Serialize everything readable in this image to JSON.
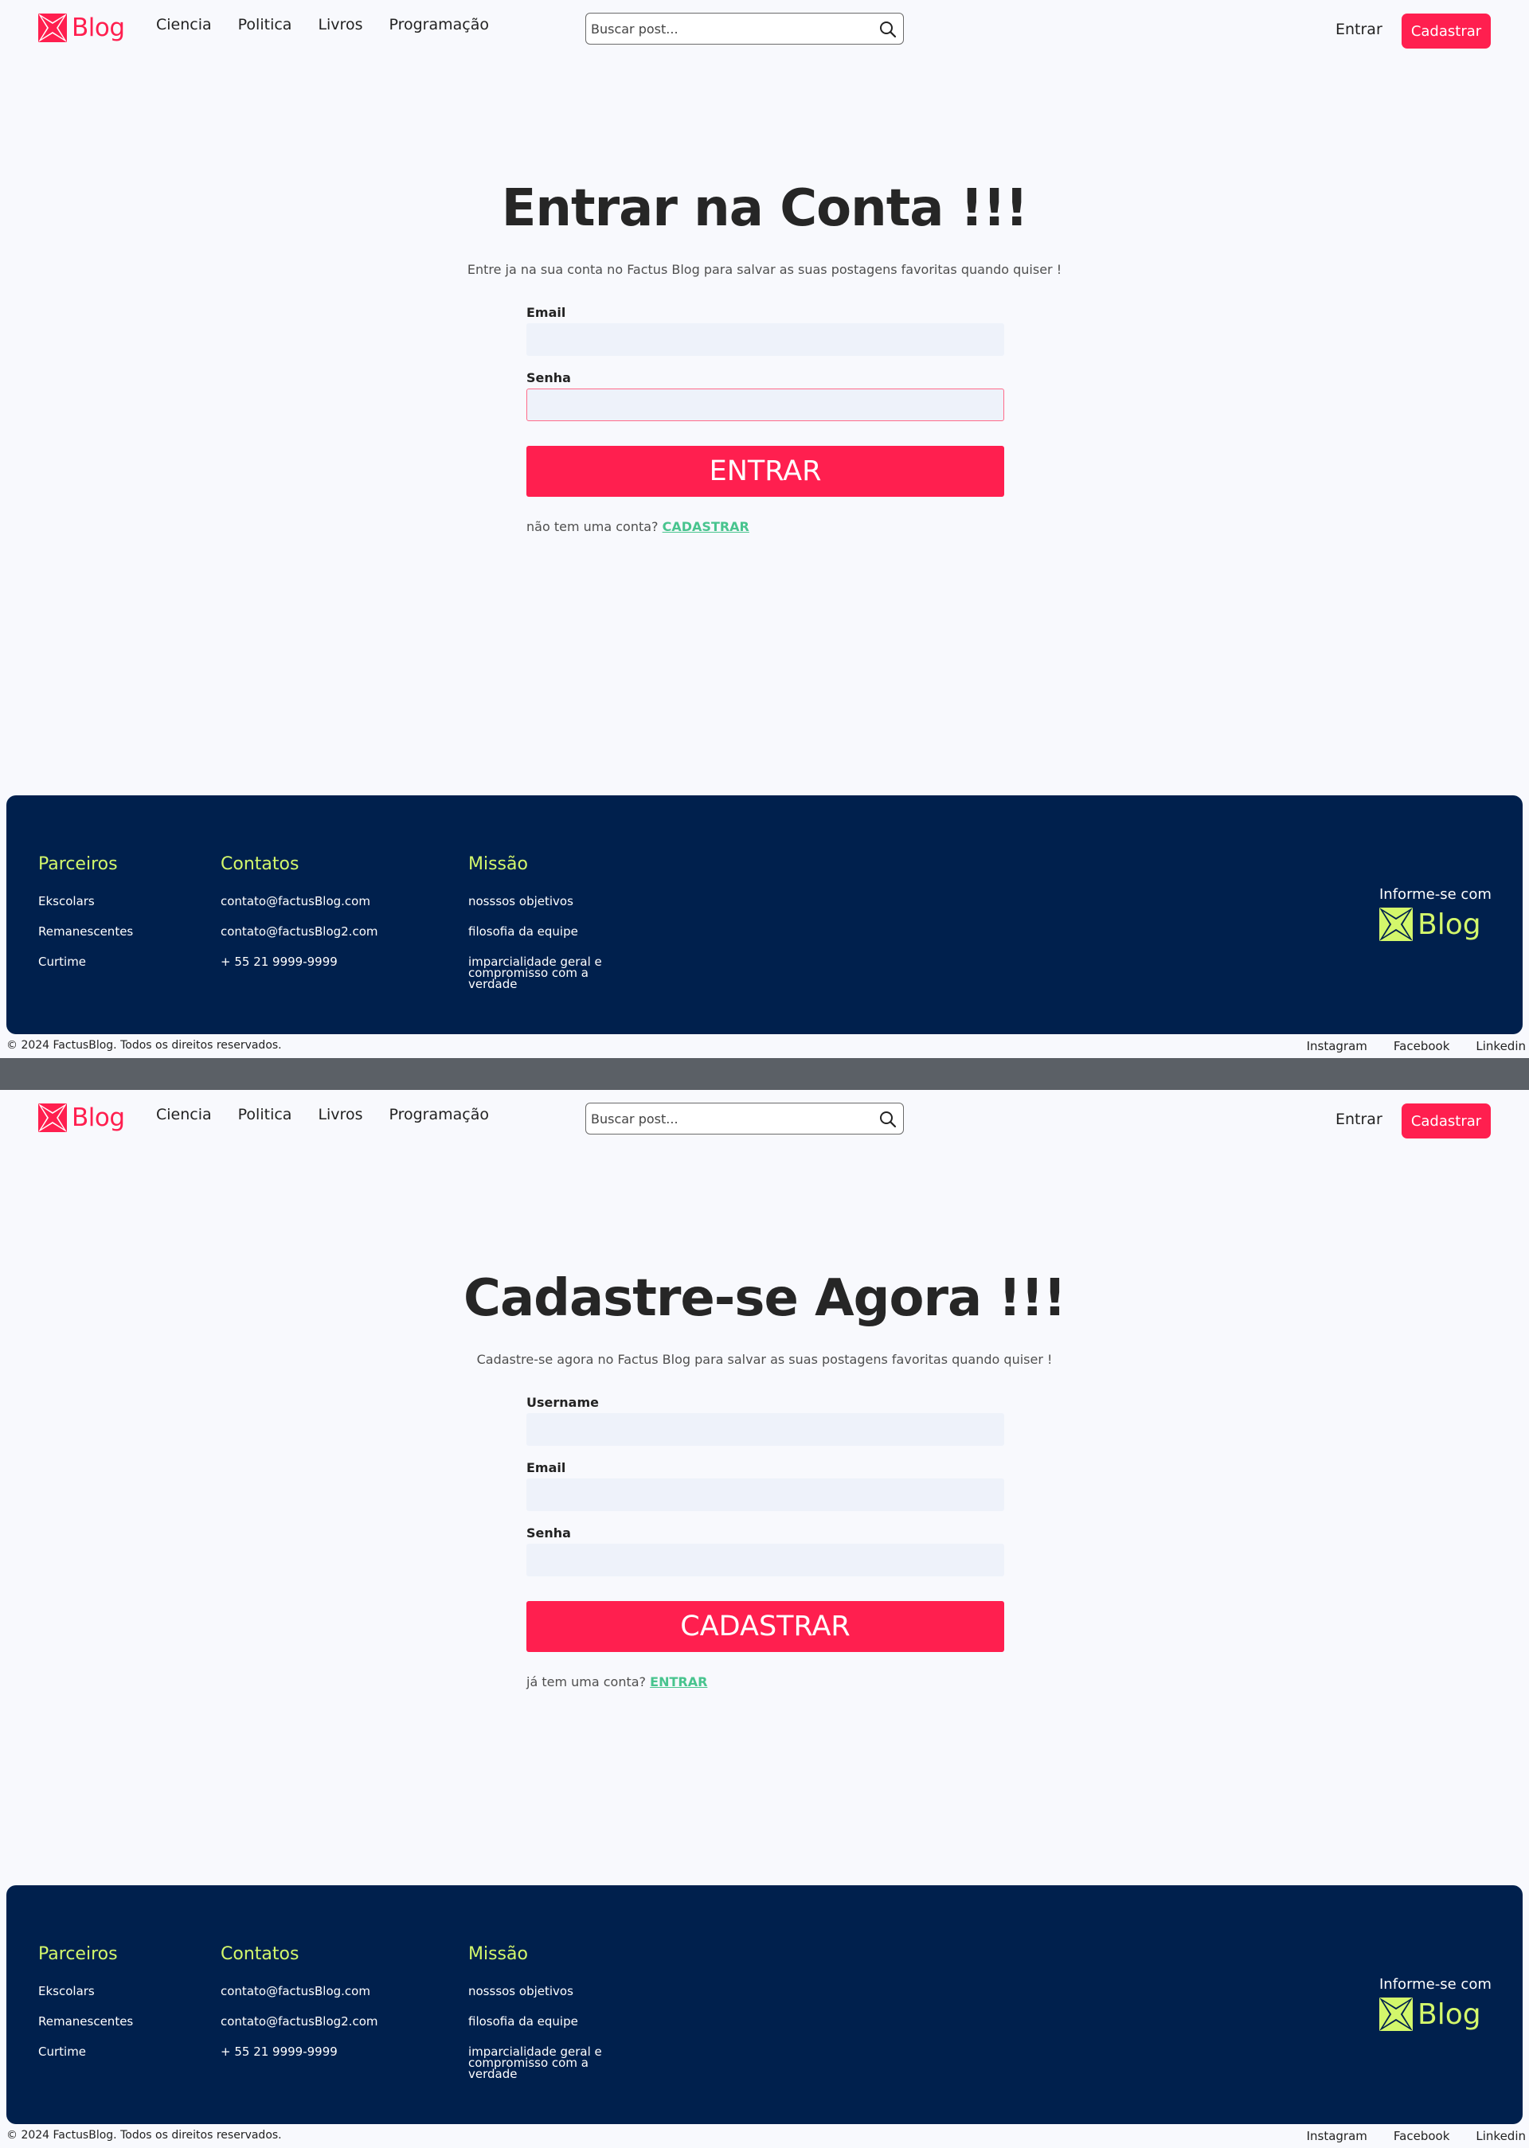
{
  "header": {
    "logo_text": "Blog",
    "nav": [
      "Ciencia",
      "Politica",
      "Livros",
      "Programação"
    ],
    "search_placeholder": "Buscar post...",
    "login_label": "Entrar",
    "signup_label": "Cadastrar"
  },
  "login": {
    "title": "Entrar na Conta !!!",
    "subtitle": "Entre ja na sua conta no Factus Blog para salvar as suas postagens favoritas quando quiser !",
    "email_label": "Email",
    "password_label": "Senha",
    "submit_label": "ENTRAR",
    "alt_text": "não tem uma conta?",
    "alt_link": "CADASTRAR"
  },
  "register": {
    "title": "Cadastre-se Agora !!!",
    "subtitle": "Cadastre-se agora no Factus Blog para salvar as suas postagens favoritas quando quiser !",
    "username_label": "Username",
    "email_label": "Email",
    "password_label": "Senha",
    "submit_label": "CADASTRAR",
    "alt_text": "já tem uma conta?",
    "alt_link": "ENTRAR"
  },
  "footer": {
    "partners": {
      "title": "Parceiros",
      "items": [
        "Ekscolars",
        "Remanescentes",
        "Curtime"
      ]
    },
    "contacts": {
      "title": "Contatos",
      "items": [
        "contato@factusBlog.com",
        "contato@factusBlog2.com",
        "+ 55 21 9999-9999"
      ]
    },
    "mission": {
      "title": "Missão",
      "items": [
        "nosssos objetivos",
        "filosofia da equipe",
        "imparcialidade geral e compromisso com a verdade"
      ]
    },
    "brand_caption": "Informe-se com",
    "brand_text": "Blog",
    "copyright": "© 2024 FactusBlog. Todos os direitos reservados.",
    "social": [
      "Instagram",
      "Facebook",
      "Linkedin"
    ]
  },
  "colors": {
    "accent": "#ff1f4f",
    "footer_bg": "#00204d",
    "footer_heading": "#d3f76b",
    "link_green": "#48c48e"
  }
}
